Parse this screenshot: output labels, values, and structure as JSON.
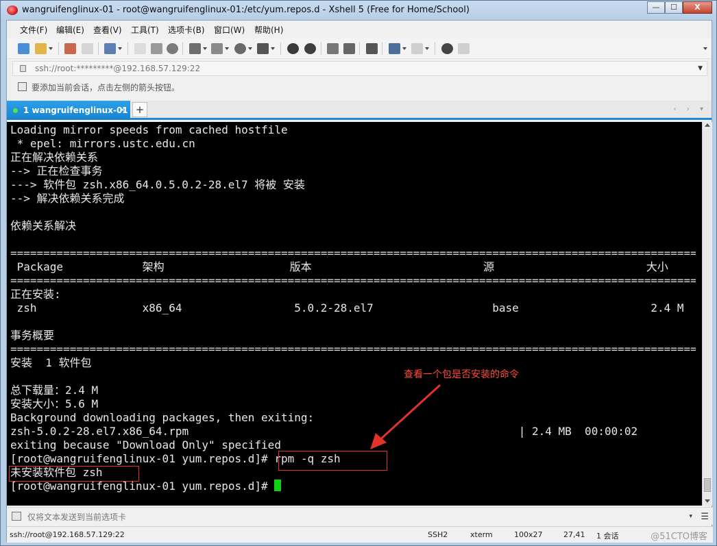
{
  "window": {
    "title": "wangruifenglinux-01 - root@wangruifenglinux-01:/etc/yum.repos.d - Xshell 5 (Free for Home/School)",
    "minimize": "—",
    "maximize": "☐",
    "close": "X"
  },
  "menu": [
    "文件(F)",
    "编辑(E)",
    "查看(V)",
    "工具(T)",
    "选项卡(B)",
    "窗口(W)",
    "帮助(H)"
  ],
  "address": {
    "value": "ssh://root:*********@192.168.57.129:22",
    "dropdown": "▼"
  },
  "hint": "要添加当前会话，点击左侧的箭头按钮。",
  "tab": {
    "label": "1 wangruifenglinux-01",
    "close": "×",
    "add": "+",
    "nav": "‹ › ▾"
  },
  "terminal": {
    "lines": [
      "Loading mirror speeds from cached hostfile",
      " * epel: mirrors.ustc.edu.cn",
      "正在解决依赖关系",
      "--> 正在检查事务",
      "---> 软件包 zsh.x86_64.0.5.0.2-28.el7 将被 安装",
      "--> 解决依赖关系完成",
      "",
      "依赖关系解决",
      "",
      "================================================================================================================",
      " Package            架构                   版本                          源                       大小",
      "================================================================================================================",
      "正在安装:",
      " zsh                x86_64                 5.0.2-28.el7                  base                    2.4 M",
      "",
      "事务概要",
      "================================================================================================================",
      "安装  1 软件包",
      "",
      "总下载量：2.4 M",
      "安装大小：5.6 M",
      "Background downloading packages, then exiting:",
      "zsh-5.0.2-28.el7.x86_64.rpm                                                  | 2.4 MB  00:00:02",
      "exiting because \"Download Only\" specified",
      "[root@wangruifenglinux-01 yum.repos.d]# rpm -q zsh",
      "未安装软件包 zsh",
      "[root@wangruifenglinux-01 yum.repos.d]# "
    ]
  },
  "annotation": {
    "text": "查看一个包是否安装的命令",
    "color": "#ff4b3a"
  },
  "sendbar": {
    "placeholder": "仅将文本发送到当前选项卡",
    "dropdown": "▾",
    "menu": "☰"
  },
  "status": {
    "connection": "ssh://root@192.168.57.129:22",
    "protocol": "SSH2",
    "term": "xterm",
    "size": "100x27",
    "cursor_pos": "27,41",
    "sessions": "1 会话",
    "watermark": "@51CTO博客"
  },
  "colors": {
    "tab_active": "#1e8ad6",
    "cursor": "#12d012",
    "annotation": "#e2332b"
  }
}
